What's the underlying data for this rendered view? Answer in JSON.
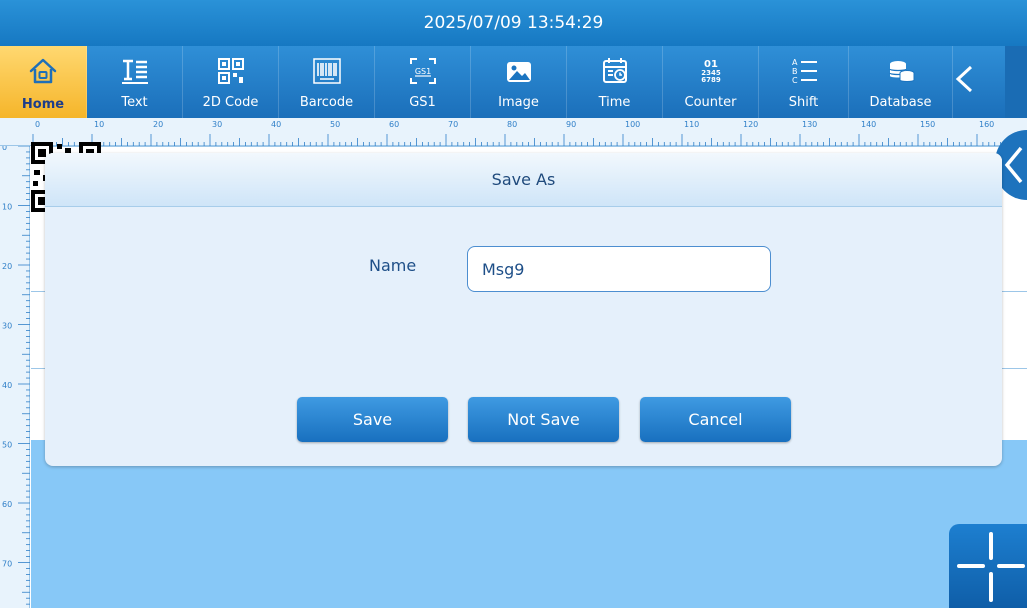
{
  "titlebar": {
    "datetime": "2025/07/09 13:54:29"
  },
  "toolbar": {
    "items": [
      {
        "label": "Home",
        "icon": "home-icon"
      },
      {
        "label": "Text",
        "icon": "text-icon"
      },
      {
        "label": "2D Code",
        "icon": "qr-code-icon"
      },
      {
        "label": "Barcode",
        "icon": "barcode-icon"
      },
      {
        "label": "GS1",
        "icon": "gs1-icon"
      },
      {
        "label": "Image",
        "icon": "image-icon"
      },
      {
        "label": "Time",
        "icon": "calendar-clock-icon"
      },
      {
        "label": "Counter",
        "icon": "counter-icon"
      },
      {
        "label": "Shift",
        "icon": "abc-list-icon"
      },
      {
        "label": "Database",
        "icon": "database-icon"
      }
    ],
    "counter_icon_text": [
      "01",
      "2345",
      "6789"
    ],
    "gs1_icon_text": "GS1"
  },
  "ruler": {
    "h_numbers": [
      "0",
      "10",
      "20",
      "30",
      "40",
      "50",
      "60",
      "70",
      "80",
      "90",
      "100",
      "110",
      "120",
      "130",
      "140",
      "150",
      "160"
    ],
    "v_numbers": [
      "0",
      "10",
      "20",
      "30",
      "40",
      "50",
      "60",
      "70"
    ]
  },
  "dialog": {
    "title": "Save As",
    "name_label": "Name",
    "name_value": "Msg9",
    "buttons": {
      "save": "Save",
      "not_save": "Not Save",
      "cancel": "Cancel"
    }
  },
  "colors": {
    "primary": "#1b74c0",
    "active_tab": "#f5b52a",
    "dialog_bg": "#e5f0fb",
    "canvas_band": "#87c8f7"
  }
}
